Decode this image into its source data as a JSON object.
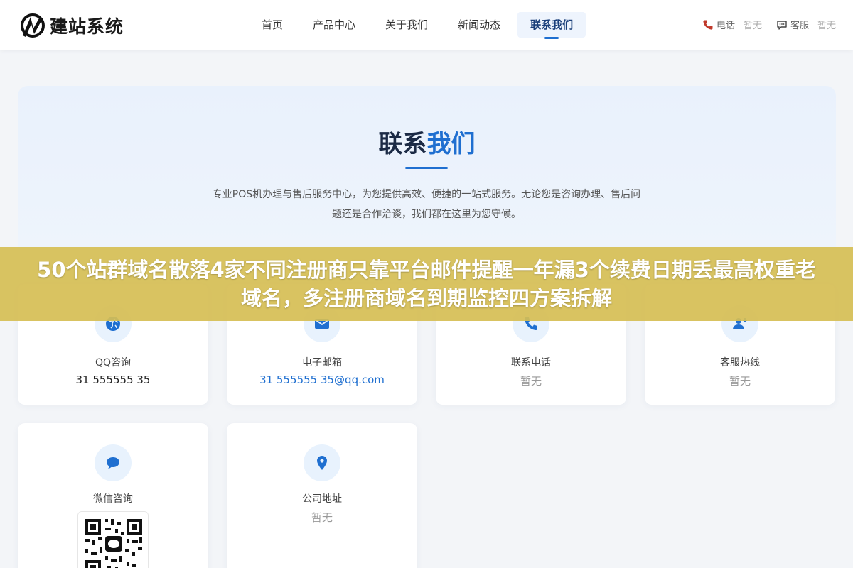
{
  "header": {
    "logo_text": "建站系统",
    "nav": [
      {
        "label": "首页"
      },
      {
        "label": "产品中心"
      },
      {
        "label": "关于我们"
      },
      {
        "label": "新闻动态"
      },
      {
        "label": "联系我们",
        "active": true
      }
    ],
    "contact": {
      "phone_label": "电话",
      "phone_value": "暂无",
      "service_label": "客服",
      "service_value": "暂无"
    }
  },
  "hero": {
    "title_part1": "联系",
    "title_part2": "我们",
    "description": "专业POS机办理与售后服务中心，为您提供高效、便捷的一站式服务。无论您是咨询办理、售后问题还是合作洽谈，我们都在这里为您守候。"
  },
  "cards": [
    {
      "label": "QQ咨询",
      "value": "31 555555 35",
      "icon": "globe-icon"
    },
    {
      "label": "电子邮箱",
      "value": "31 555555 35@qq.com",
      "icon": "mail-icon"
    },
    {
      "label": "联系电话",
      "value": "暂无",
      "icon": "phone-icon"
    },
    {
      "label": "客服热线",
      "value": "暂无",
      "icon": "user-plus-icon"
    },
    {
      "label": "微信咨询",
      "icon": "chat-bubble-icon"
    },
    {
      "label": "公司地址",
      "value": "暂无",
      "icon": "location-pin-icon"
    }
  ],
  "banner": {
    "text": "50个站群域名散落4家不同注册商只靠平台邮件提醒一年漏3个续费日期丢最高权重老域名，多注册商域名到期监控四方案拆解"
  },
  "colors": {
    "accent": "#1f6fd0",
    "banner_bg": "#d6be54",
    "page_bg": "#f3f5f8"
  }
}
